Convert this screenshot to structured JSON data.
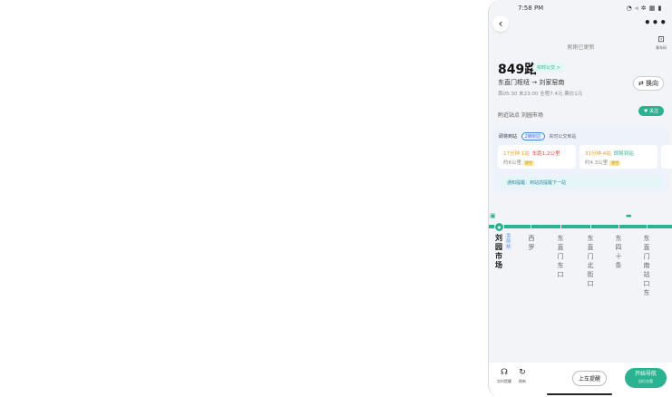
{
  "status": {
    "time": "7:58 PM",
    "icons": "◔ ◃ ✲ ▦ ▮"
  },
  "nav": {
    "back": "‹",
    "more": "•••",
    "qr_icon": "⊡",
    "qr_label": "乘车码"
  },
  "updated": "刚刚已更新",
  "route": {
    "number": "849路",
    "dynamic": "实时公交 >",
    "direction": "东直门枢纽 → 刘家窑南",
    "hours": "首05:30 末23:00  全程7.4元  票价1元",
    "swap": "⇄ 换向",
    "follow": "♥ 关注",
    "nearby": "附近站点 刘园市场"
  },
  "buses": {
    "header_prefix": "即将到站",
    "header_selected": "2辆到达",
    "header_more": "实时公交到站",
    "items": [
      {
        "eta": "17分钟·1站",
        "note": "车距1.2公里",
        "dist": "约6公里",
        "tag": "较空"
      },
      {
        "eta": "31分钟·4站",
        "note": "即将到站",
        "dist": "约4.3公里",
        "tag": "较空"
      },
      {
        "eta": "",
        "note": "",
        "dist": "",
        "tag": ""
      }
    ],
    "remind": "通知提醒：到站前提醒下一站"
  },
  "stops": [
    {
      "name": "刘园市场",
      "current": true
    },
    {
      "name": "西罗"
    },
    {
      "name": "东直门东口"
    },
    {
      "name": "东直门北街口"
    },
    {
      "name": "东四十条"
    },
    {
      "name": "东直门南站口东"
    }
  ],
  "stop_tag": "当前站",
  "bottom": {
    "icon1": "☊",
    "icon1_label": "实时提醒",
    "icon2": "↻",
    "icon2_label": "刷新",
    "remind": "上车提醒",
    "nav": "开始导航",
    "nav_sub": "出行方案"
  }
}
